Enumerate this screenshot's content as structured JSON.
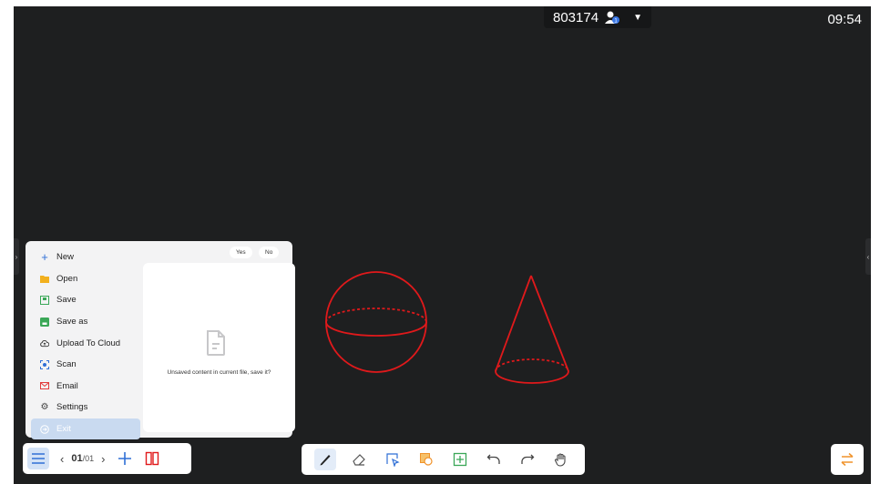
{
  "topbar": {
    "room_code": "803174",
    "user_count": "1",
    "clock": "09:54"
  },
  "menu": {
    "items": [
      {
        "label": "New",
        "icon": "plus-icon"
      },
      {
        "label": "Open",
        "icon": "folder-icon"
      },
      {
        "label": "Save",
        "icon": "save-icon"
      },
      {
        "label": "Save as",
        "icon": "save-as-icon"
      },
      {
        "label": "Upload To Cloud",
        "icon": "cloud-upload-icon"
      },
      {
        "label": "Scan",
        "icon": "scan-icon"
      },
      {
        "label": "Email",
        "icon": "email-icon"
      },
      {
        "label": "Settings",
        "icon": "gear-icon"
      },
      {
        "label": "Exit",
        "icon": "exit-icon"
      }
    ]
  },
  "confirm": {
    "message": "Unsaved content in current file, save it?",
    "yes_label": "Yes",
    "no_label": "No"
  },
  "pager": {
    "current": "01",
    "total": "/01"
  },
  "colors": {
    "board": "#1e1f20",
    "shape_stroke": "#e0191b",
    "accent": "#2f6fd6"
  }
}
